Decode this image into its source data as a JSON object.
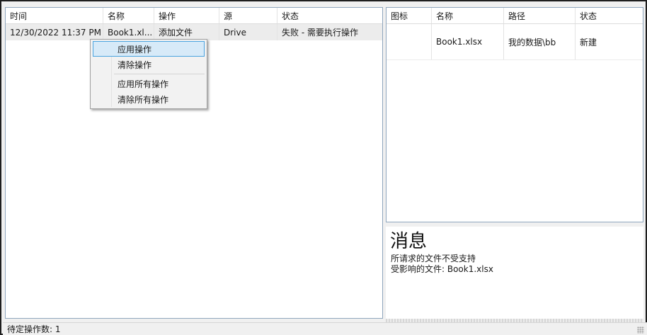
{
  "left_grid": {
    "columns": [
      "时间",
      "名称",
      "操作",
      "源",
      "状态"
    ],
    "rows": [
      [
        "12/30/2022 11:37 PM",
        "Book1.xl...",
        "添加文件",
        "Drive",
        "失败 - 需要执行操作"
      ]
    ]
  },
  "context_menu": {
    "items": [
      "应用操作",
      "清除操作",
      "应用所有操作",
      "清除所有操作"
    ],
    "active_index": 0
  },
  "right_grid": {
    "columns": [
      "图标",
      "名称",
      "路径",
      "状态"
    ],
    "rows": [
      [
        "",
        "Book1.xlsx",
        "我的数据\\bb",
        "新建"
      ]
    ]
  },
  "messages": {
    "title": "消息",
    "lines": [
      "所请求的文件不受支持",
      "受影响的文件: Book1.xlsx"
    ]
  },
  "status_bar": {
    "text": "待定操作数: 1"
  }
}
